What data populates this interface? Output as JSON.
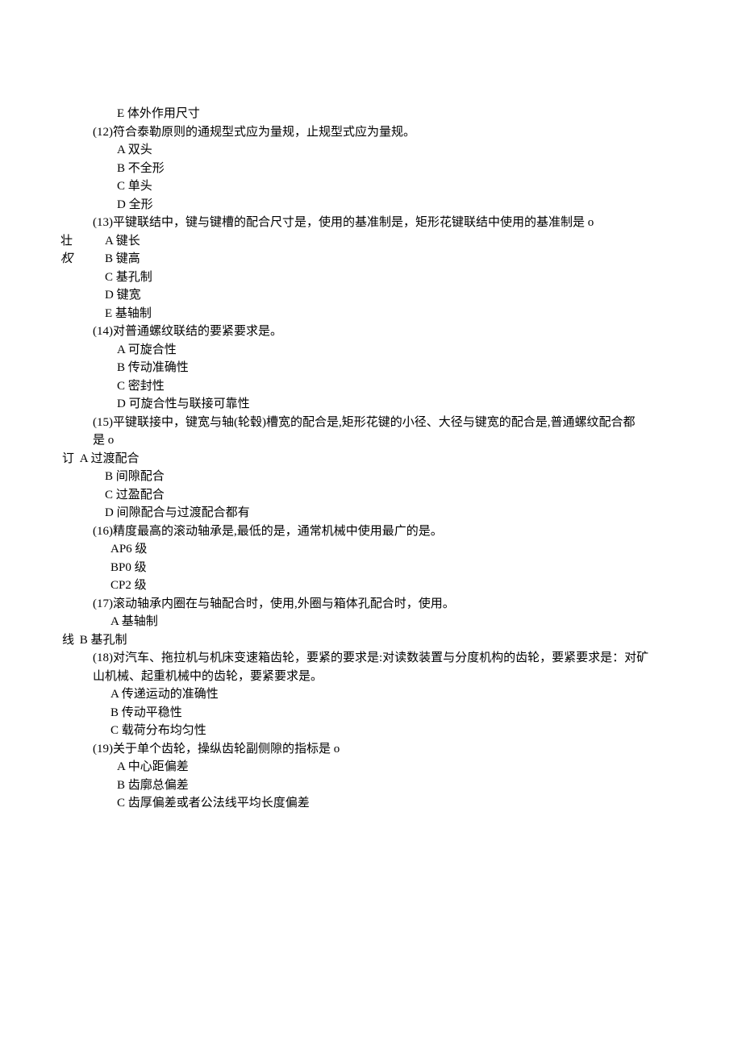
{
  "margin": {
    "zhuang": "壮",
    "quan": "权",
    "ding": "订",
    "xian": "线"
  },
  "q11": {
    "optE": "E 体外作用尺寸"
  },
  "q12": {
    "text": "(12)符合泰勒原则的通规型式应为量规，止规型式应为量规。",
    "optA": "A 双头",
    "optB": "B 不全形",
    "optC": "C 单头",
    "optD": "D 全形"
  },
  "q13": {
    "text": "(13)平键联结中，键与键槽的配合尺寸是，使用的基准制是，矩形花键联结中使用的基准制是 o",
    "optA": "A 键长",
    "optB": "B 键高",
    "optC": "C 基孔制",
    "optD": "D 键宽",
    "optE": "E 基轴制"
  },
  "q14": {
    "text": "(14)对普通螺纹联结的要紧要求是。",
    "optA": "A 可旋合性",
    "optB": "B 传动准确性",
    "optC": "C 密封性",
    "optD": "D 可旋合性与联接可靠性"
  },
  "q15": {
    "text1": "(15)平键联接中，键宽与轴(轮毂)槽宽的配合是,矩形花键的小径、大径与键宽的配合是,普通螺纹配合都",
    "text2": "是 o",
    "optA": "A 过渡配合",
    "optB": "B 间隙配合",
    "optC": "C 过盈配合",
    "optD": "D 间隙配合与过渡配合都有"
  },
  "q16": {
    "text": "(16)精度最高的滚动轴承是,最低的是，通常机械中使用最广的是。",
    "optA": "AP6 级",
    "optB": "BP0 级",
    "optC": "CP2 级"
  },
  "q17": {
    "text": "(17)滚动轴承内圈在与轴配合时，使用,外圈与箱体孔配合时，使用。",
    "optA": "A 基轴制",
    "optB": "B 基孔制"
  },
  "q18": {
    "text1": "(18)对汽车、拖拉机与机床变速箱齿轮，要紧的要求是:对读数装置与分度机构的齿轮，要紧要求是：对矿",
    "text2": "山机械、起重机械中的齿轮，要紧要求是。",
    "optA": "A 传递运动的准确性",
    "optB": "B 传动平稳性",
    "optC": "C 载荷分布均匀性"
  },
  "q19": {
    "text": "(19)关于单个齿轮，操纵齿轮副侧隙的指标是 o",
    "optA": "A 中心距偏差",
    "optB": "B 齿廓总偏差",
    "optC": "C 齿厚偏差或者公法线平均长度偏差"
  }
}
